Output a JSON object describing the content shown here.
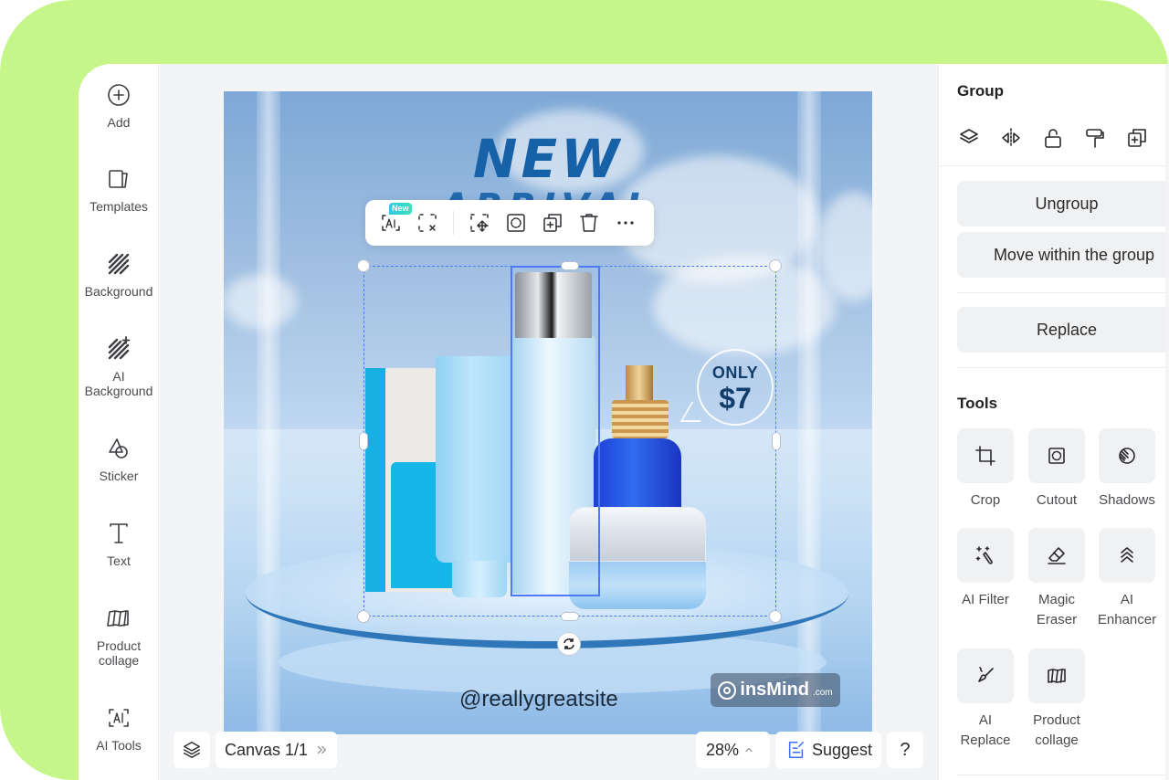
{
  "colors": {
    "frame_bg": "#c6f68a",
    "selection": "#4d79f6",
    "headline": "#1661a8",
    "suggest_icon": "#3b6ef5",
    "new_badge": "#2fc9e8"
  },
  "sidebar": {
    "items": [
      {
        "label": "Add",
        "icon": "plus-circle-icon"
      },
      {
        "label": "Templates",
        "icon": "templates-icon"
      },
      {
        "label": "Background",
        "icon": "background-hatch-icon"
      },
      {
        "label": "AI\nBackground",
        "label_line1": "AI",
        "label_line2": "Background",
        "icon": "ai-background-icon"
      },
      {
        "label": "Sticker",
        "icon": "sticker-shapes-icon"
      },
      {
        "label": "Text",
        "icon": "text-t-icon"
      },
      {
        "label": "Product collage",
        "label_line1": "Product",
        "label_line2": "collage",
        "icon": "product-collage-icon"
      },
      {
        "label": "AI Tools",
        "icon": "ai-tools-icon"
      }
    ]
  },
  "canvas": {
    "headline": "NEW",
    "headline_sub": "ARRIVAL",
    "bubble_top": "ONLY",
    "bubble_price": "$7",
    "site_text": "@reallygreatsite",
    "watermark_brand": "insMind",
    "watermark_suffix": ".com"
  },
  "float_toolbar": {
    "new_badge": "New",
    "buttons": [
      {
        "name": "ai-edit",
        "icon": "ai-frame-icon"
      },
      {
        "name": "remove-selection",
        "icon": "dashed-x-icon"
      },
      {
        "name": "move",
        "icon": "dashed-move-icon"
      },
      {
        "name": "cutout",
        "icon": "cutout-icon"
      },
      {
        "name": "duplicate",
        "icon": "duplicate-icon"
      },
      {
        "name": "delete",
        "icon": "trash-icon"
      },
      {
        "name": "more",
        "icon": "more-dots-icon"
      }
    ]
  },
  "bottom_bar": {
    "canvas_label": "Canvas 1/1",
    "zoom": "28%",
    "suggest_label": "Suggest",
    "help_label": "?"
  },
  "right_panel": {
    "group_title": "Group",
    "group_icons": [
      "layers-icon",
      "flip-icon",
      "unlock-icon",
      "paint-roller-icon",
      "duplicate-icon"
    ],
    "ungroup_label": "Ungroup",
    "move_within_label": "Move within the group",
    "replace_label": "Replace",
    "tools_title": "Tools",
    "tools": [
      {
        "label": "Crop",
        "icon": "crop-icon"
      },
      {
        "label": "Cutout",
        "icon": "cutout-icon"
      },
      {
        "label": "Shadows",
        "icon": "shadows-icon"
      },
      {
        "label": "AI Filter",
        "icon": "magic-wand-icon"
      },
      {
        "label_line1": "Magic",
        "label_line2": "Eraser",
        "icon": "eraser-icon"
      },
      {
        "label_line1": "AI",
        "label_line2": "Enhancer",
        "icon": "enhancer-chevrons-icon"
      },
      {
        "label_line1": "AI",
        "label_line2": "Replace",
        "icon": "brush-replace-icon"
      },
      {
        "label_line1": "Product",
        "label_line2": "collage",
        "icon": "product-collage-icon"
      }
    ]
  }
}
